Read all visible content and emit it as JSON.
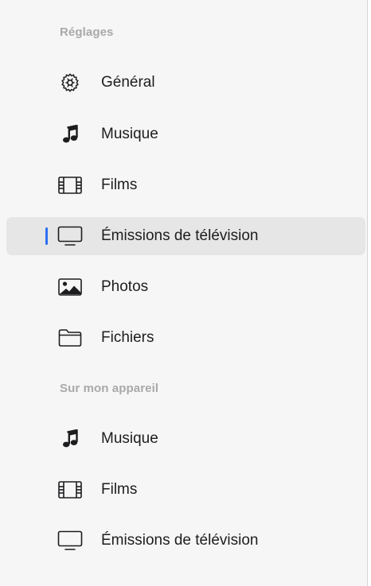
{
  "sidebar": {
    "sections": [
      {
        "header": "Réglages",
        "items": [
          {
            "label": "Général",
            "icon": "gear-icon"
          },
          {
            "label": "Musique",
            "icon": "music-note-icon"
          },
          {
            "label": "Films",
            "icon": "film-icon"
          },
          {
            "label": "Émissions de télévision",
            "icon": "tv-icon",
            "selected": true
          },
          {
            "label": "Photos",
            "icon": "photo-icon"
          },
          {
            "label": "Fichiers",
            "icon": "folder-icon"
          }
        ]
      },
      {
        "header": "Sur mon appareil",
        "items": [
          {
            "label": "Musique",
            "icon": "music-note-icon"
          },
          {
            "label": "Films",
            "icon": "film-icon"
          },
          {
            "label": "Émissions de télévision",
            "icon": "tv-icon"
          }
        ]
      }
    ]
  },
  "colors": {
    "accent": "#2f6ff0",
    "selected_background": "#e6e6e6",
    "header_text": "#a9a9a9",
    "item_text": "#1d1d1f"
  }
}
